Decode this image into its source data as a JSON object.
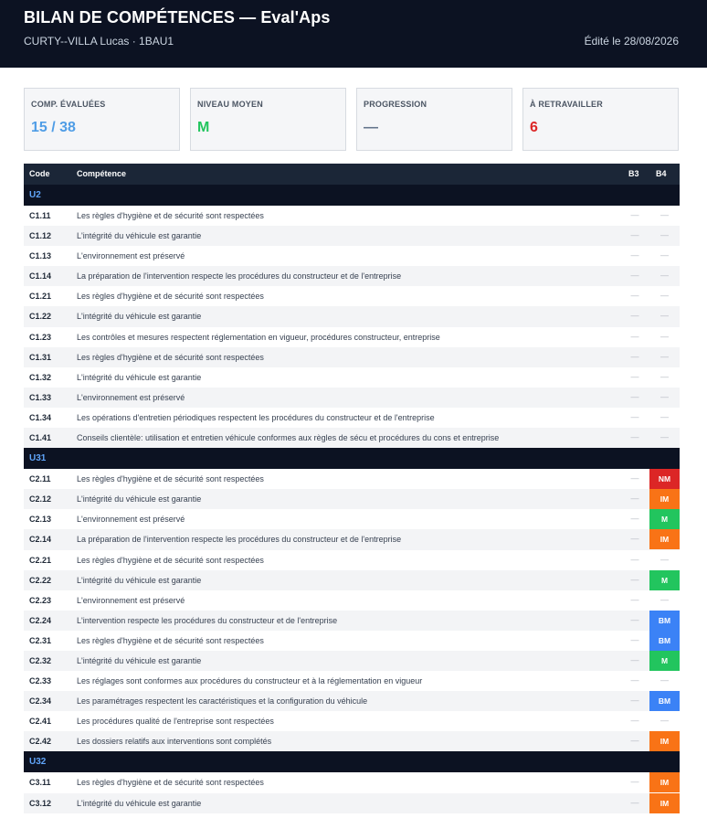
{
  "header": {
    "title": "BILAN DE COMPÉTENCES — Eval'Aps",
    "subtitle": "CURTY--VILLA Lucas · 1BAU1",
    "edited": "Édité le 28/08/2026"
  },
  "cards": [
    {
      "label": "COMP. ÉVALUÉES",
      "value": "15 / 38",
      "color": "#4f9de6"
    },
    {
      "label": "NIVEAU MOYEN",
      "value": "M",
      "color": "#22c55e"
    },
    {
      "label": "PROGRESSION",
      "value": "—",
      "color": "#64748b"
    },
    {
      "label": "À RETRAVAILLER",
      "value": "6",
      "color": "#dc2626"
    }
  ],
  "table": {
    "headers": {
      "code": "Code",
      "competence": "Compétence",
      "b3": "B3",
      "b4": "B4"
    },
    "empty_mark": "—",
    "badge_colors": {
      "NM": "#dc2626",
      "IM": "#f97316",
      "M": "#22c55e",
      "BM": "#3b82f6"
    },
    "groups": [
      {
        "name": "U2",
        "rows": [
          {
            "code": "C1.11",
            "text": "Les règles d'hygiène et de sécurité sont respectées",
            "b3": "",
            "b4": ""
          },
          {
            "code": "C1.12",
            "text": "L'intégrité du véhicule est garantie",
            "b3": "",
            "b4": ""
          },
          {
            "code": "C1.13",
            "text": "L'environnement est préservé",
            "b3": "",
            "b4": ""
          },
          {
            "code": "C1.14",
            "text": "La préparation de l'intervention respecte les procédures du constructeur et de l'entreprise",
            "b3": "",
            "b4": ""
          },
          {
            "code": "C1.21",
            "text": "Les règles d'hygiène et de sécurité sont respectées",
            "b3": "",
            "b4": ""
          },
          {
            "code": "C1.22",
            "text": "L'intégrité du véhicule est garantie",
            "b3": "",
            "b4": ""
          },
          {
            "code": "C1.23",
            "text": "Les contrôles et mesures respectent réglementation en vigueur, procédures constructeur, entreprise",
            "b3": "",
            "b4": ""
          },
          {
            "code": "C1.31",
            "text": "Les règles d'hygiène et de sécurité sont respectées",
            "b3": "",
            "b4": ""
          },
          {
            "code": "C1.32",
            "text": "L'intégrité du véhicule est garantie",
            "b3": "",
            "b4": ""
          },
          {
            "code": "C1.33",
            "text": "L'environnement est préservé",
            "b3": "",
            "b4": ""
          },
          {
            "code": "C1.34",
            "text": "Les opérations d'entretien périodiques respectent les procédures du constructeur et de l'entreprise",
            "b3": "",
            "b4": ""
          },
          {
            "code": "C1.41",
            "text": "Conseils clientèle: utilisation et entretien véhicule conformes aux règles de sécu et procédures du cons et entreprise",
            "b3": "",
            "b4": ""
          }
        ]
      },
      {
        "name": "U31",
        "rows": [
          {
            "code": "C2.11",
            "text": "Les règles d'hygiène et de sécurité sont respectées",
            "b3": "",
            "b4": "NM"
          },
          {
            "code": "C2.12",
            "text": "L'intégrité du véhicule est garantie",
            "b3": "",
            "b4": "IM"
          },
          {
            "code": "C2.13",
            "text": "L'environnement est préservé",
            "b3": "",
            "b4": "M"
          },
          {
            "code": "C2.14",
            "text": "La préparation de l'intervention respecte les procédures du constructeur et de l'entreprise",
            "b3": "",
            "b4": "IM"
          },
          {
            "code": "C2.21",
            "text": "Les règles d'hygiène et de sécurité sont respectées",
            "b3": "",
            "b4": ""
          },
          {
            "code": "C2.22",
            "text": "L'intégrité du véhicule est garantie",
            "b3": "",
            "b4": "M"
          },
          {
            "code": "C2.23",
            "text": "L'environnement est préservé",
            "b3": "",
            "b4": ""
          },
          {
            "code": "C2.24",
            "text": "L'intervention respecte les procédures du constructeur et de l'entreprise",
            "b3": "",
            "b4": "BM"
          },
          {
            "code": "C2.31",
            "text": "Les règles d'hygiène et de sécurité sont respectées",
            "b3": "",
            "b4": "BM"
          },
          {
            "code": "C2.32",
            "text": "L'intégrité du véhicule est garantie",
            "b3": "",
            "b4": "M"
          },
          {
            "code": "C2.33",
            "text": "Les réglages sont conformes aux procédures du constructeur et à la réglementation en vigueur",
            "b3": "",
            "b4": ""
          },
          {
            "code": "C2.34",
            "text": "Les paramétrages respectent les caractéristiques et la configuration du véhicule",
            "b3": "",
            "b4": "BM"
          },
          {
            "code": "C2.41",
            "text": "Les procédures qualité de l'entreprise sont respectées",
            "b3": "",
            "b4": ""
          },
          {
            "code": "C2.42",
            "text": "Les dossiers relatifs aux interventions sont complétés",
            "b3": "",
            "b4": "IM"
          }
        ]
      },
      {
        "name": "U32",
        "rows": [
          {
            "code": "C3.11",
            "text": "Les règles d'hygiène et de sécurité sont respectées",
            "b3": "",
            "b4": "IM"
          },
          {
            "code": "C3.12",
            "text": "L'intégrité du véhicule est garantie",
            "b3": "",
            "b4": "IM"
          }
        ]
      }
    ]
  }
}
